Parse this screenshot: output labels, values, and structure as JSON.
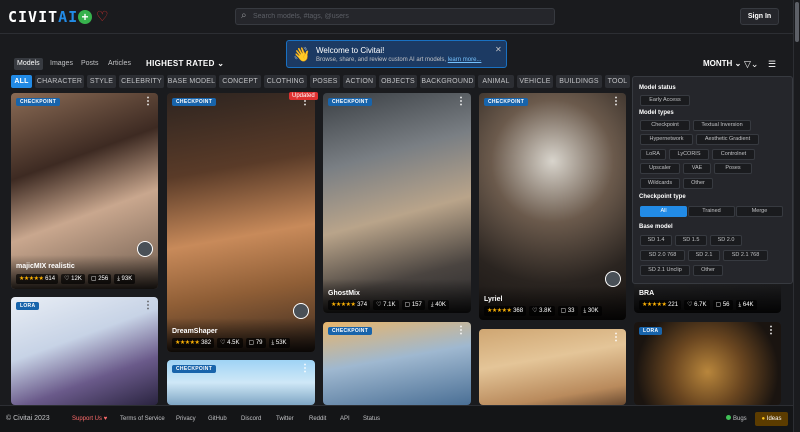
{
  "header": {
    "logo_main": "CIVIT",
    "logo_ai": "AI",
    "search_placeholder": "Search models, #tags, @users",
    "signin_label": "Sign In"
  },
  "subnav": {
    "tabs": [
      "Models",
      "Images",
      "Posts",
      "Articles"
    ],
    "active_tab": "Models",
    "sort": "HIGHEST RATED",
    "period": "MONTH"
  },
  "toast": {
    "title": "Welcome to Civitai!",
    "body": "Browse, share, and review custom AI art models,",
    "link": "learn more..."
  },
  "categories": [
    "ALL",
    "CHARACTER",
    "STYLE",
    "CELEBRITY",
    "BASE MODEL",
    "CONCEPT",
    "CLOTHING",
    "POSES",
    "ACTION",
    "OBJECTS",
    "BACKGROUND",
    "ANIMAL",
    "VEHICLE",
    "BUILDINGS",
    "TOOL"
  ],
  "cards": [
    {
      "badge": "CHECKPOINT",
      "title": "majicMIX realistic",
      "rating": "614",
      "likes": "12K",
      "comments": "256",
      "downloads": "93K"
    },
    {
      "badge": "CHECKPOINT",
      "updated": "Updated",
      "title": "DreamShaper",
      "rating": "382",
      "likes": "4.5K",
      "comments": "79",
      "downloads": "53K"
    },
    {
      "badge": "CHECKPOINT",
      "title": "GhostMix",
      "rating": "374",
      "likes": "7.1K",
      "comments": "157",
      "downloads": "40K"
    },
    {
      "badge": "CHECKPOINT",
      "title": "Lyriel",
      "rating": "368",
      "likes": "3.8K",
      "comments": "33",
      "downloads": "30K"
    },
    {
      "badge": "CHECKPOINT",
      "title": "BRA",
      "rating": "221",
      "likes": "6.7K",
      "comments": "56",
      "downloads": "64K"
    },
    {
      "badge": "LORA"
    },
    {
      "badge": "CHECKPOINT"
    },
    {
      "badge": "CHECKPOINT"
    },
    {
      "badge": "LORA"
    }
  ],
  "stars": "★★★★★",
  "filter_panel": {
    "model_status_title": "Model status",
    "model_status_options": [
      "Early Access"
    ],
    "model_types_title": "Model types",
    "model_types": [
      "Checkpoint",
      "Textual Inversion",
      "Hypernetwork",
      "Aesthetic Gradient",
      "LoRA",
      "LyCORIS",
      "Controlnet",
      "Upscaler",
      "VAE",
      "Poses",
      "Wildcards",
      "Other"
    ],
    "checkpoint_type_title": "Checkpoint type",
    "checkpoint_types": [
      "All",
      "Trained",
      "Merge"
    ],
    "base_model_title": "Base model",
    "base_models": [
      "SD 1.4",
      "SD 1.5",
      "SD 2.0",
      "SD 2.0 768",
      "SD 2.1",
      "SD 2.1 768",
      "SD 2.1 Unclip",
      "Other"
    ]
  },
  "footer": {
    "copyright": "© Civitai 2023",
    "links": [
      "Support Us ♥",
      "Terms of Service",
      "Privacy",
      "GitHub",
      "Discord",
      "Twitter",
      "Reddit",
      "API",
      "Status"
    ],
    "bugs": "Bugs",
    "ideas": "Ideas"
  },
  "colors": {
    "accent": "#228be6",
    "background": "#1a1b1e",
    "card": "#25262b",
    "stars": "#fab005"
  }
}
